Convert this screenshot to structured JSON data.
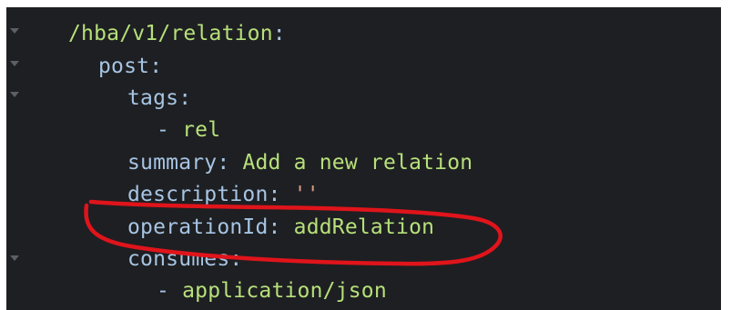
{
  "editor": {
    "fold_markers": [
      "fold-icon",
      "fold-icon",
      "fold-icon",
      "fold-icon"
    ],
    "lines": [
      {
        "key": "/hba/v1/relation",
        "sep": ":",
        "value": ""
      },
      {
        "key": "post",
        "sep": ":",
        "value": ""
      },
      {
        "key": "tags",
        "sep": ":",
        "value": ""
      },
      {
        "key": "",
        "sep": "- ",
        "value": "rel"
      },
      {
        "key": "summary",
        "sep": ": ",
        "value": "Add a new relation"
      },
      {
        "key": "description",
        "sep": ": ",
        "value": "''"
      },
      {
        "key": "operationId",
        "sep": ": ",
        "value": "addRelation"
      },
      {
        "key": "consumes",
        "sep": ":",
        "value": ""
      },
      {
        "key": "",
        "sep": "- ",
        "value": "application/json"
      }
    ]
  },
  "annotation": {
    "stroke_color": "#e0141b",
    "shape": "hand-drawn-ellipse"
  }
}
